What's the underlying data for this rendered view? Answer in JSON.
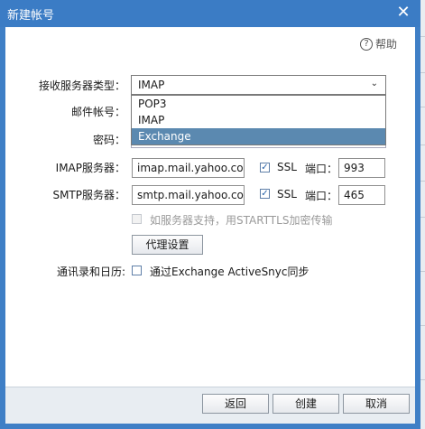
{
  "window": {
    "title": "新建帐号"
  },
  "help": {
    "label": "帮助",
    "icon": "question-circle-icon"
  },
  "labels": {
    "server_type": "接收服务器类型：",
    "account": "邮件帐号：",
    "password": "密码：",
    "imap_server": "IMAP服务器：",
    "smtp_server": "SMTP服务器：",
    "contacts_calendar": "通讯录和日历:"
  },
  "server_type": {
    "selected": "IMAP",
    "options": [
      "POP3",
      "IMAP",
      "Exchange"
    ],
    "highlighted": "Exchange"
  },
  "imap": {
    "server": "imap.mail.yahoo.com",
    "ssl_label": "SSL",
    "ssl_checked": true,
    "port_label": "端口：",
    "port": "993"
  },
  "smtp": {
    "server": "smtp.mail.yahoo.com",
    "ssl_label": "SSL",
    "ssl_checked": true,
    "port_label": "端口：",
    "port": "465"
  },
  "starttls": {
    "label": "如服务器支持，用STARTTLS加密传输",
    "checked": false,
    "disabled": true
  },
  "proxy_button": "代理设置",
  "exchange_sync": {
    "label": "通过Exchange ActiveSnyc同步",
    "checked": false
  },
  "footer": {
    "back": "返回",
    "create": "创建",
    "cancel": "取消"
  },
  "colors": {
    "titlebar": "#3b7cc5",
    "highlight": "#5b89b0"
  }
}
